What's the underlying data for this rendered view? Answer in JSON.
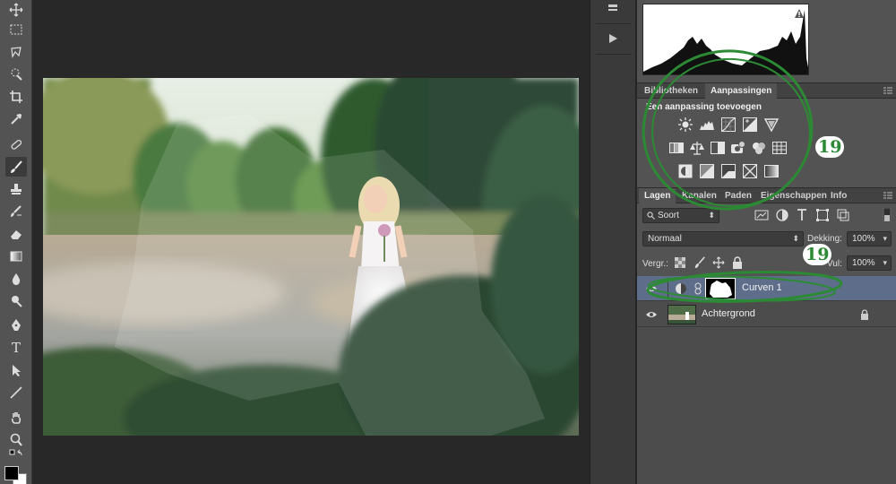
{
  "toolbar": {
    "tools": [
      "move-icon",
      "marquee-icon",
      "lasso-icon",
      "quick-select-icon",
      "crop-icon",
      "eyedropper-icon",
      "healing-brush-icon",
      "brush-icon",
      "clone-stamp-icon",
      "history-brush-icon",
      "eraser-icon",
      "gradient-icon",
      "blur-icon",
      "dodge-icon",
      "pen-icon",
      "type-icon",
      "path-select-icon",
      "line-icon",
      "hand-icon",
      "zoom-icon"
    ],
    "active_tool": "brush-icon",
    "type_glyph": "T",
    "foreground_color": "#000000",
    "background_color": "#ffffff"
  },
  "adjustments_panel": {
    "tabs": [
      "Bibliotheken",
      "Aanpassingen"
    ],
    "active_tab": "Aanpassingen",
    "title": "Een aanpassing toevoegen",
    "icons_row1": [
      "brightness-icon",
      "levels-icon",
      "curves-icon",
      "exposure-icon",
      "vibrance-icon"
    ],
    "icons_row2": [
      "hue-saturation-icon",
      "color-balance-icon",
      "black-white-icon",
      "photo-filter-icon",
      "channel-mixer-icon",
      "color-lookup-icon"
    ],
    "icons_row3": [
      "invert-icon",
      "posterize-icon",
      "threshold-icon",
      "selective-color-icon",
      "gradient-map-icon"
    ]
  },
  "layers_panel": {
    "tabs": [
      "Lagen",
      "Kanalen",
      "Paden",
      "Eigenschappen",
      "Info"
    ],
    "active_tab": "Lagen",
    "filter_kind": "Soort",
    "blend_mode": "Normaal",
    "opacity_label": "Dekking:",
    "opacity_value": "100%",
    "lock_label": "Vergr.:",
    "fill_label": "Vul:",
    "fill_value": "100%",
    "layers": [
      {
        "name": "Curven 1",
        "selected": true,
        "visible": true
      },
      {
        "name": "Achtergrond",
        "selected": false,
        "visible": true,
        "locked": true
      }
    ]
  },
  "annotations": [
    "19",
    "19"
  ],
  "colors": {
    "annotation_green": "#2c8a35",
    "selected_layer": "#5e6e8a"
  }
}
